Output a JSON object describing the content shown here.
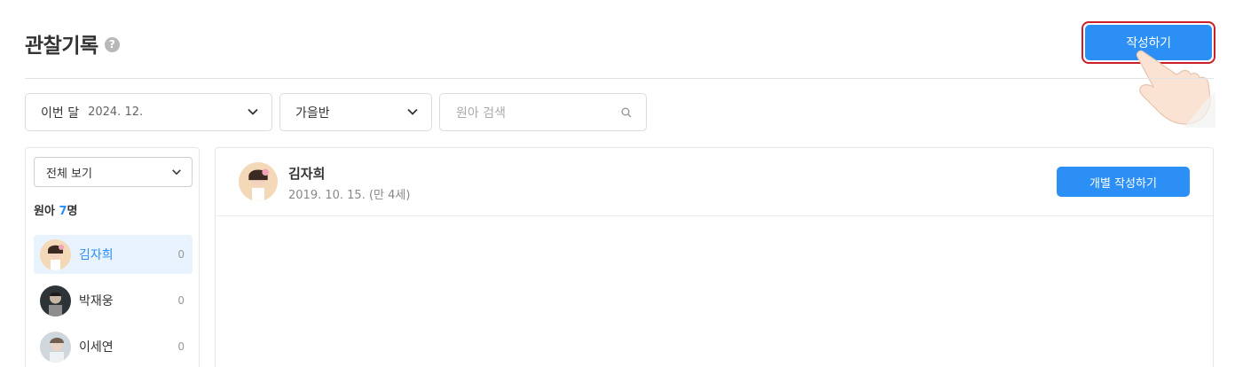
{
  "header": {
    "title": "관찰기록",
    "help_icon": "?",
    "write_button": "작성하기"
  },
  "filters": {
    "month_label": "이번 달",
    "month_value": "2024. 12.",
    "class_value": "가을반",
    "search_placeholder": "원아 검색"
  },
  "sidebar": {
    "view_select": "전체 보기",
    "count_prefix": "원아 ",
    "count_number": "7",
    "count_suffix": "명",
    "children": [
      {
        "name": "김자희",
        "count": "0",
        "active": true,
        "avatar": "avatar-child-pink"
      },
      {
        "name": "박재웅",
        "count": "0",
        "active": false,
        "avatar": "avatar-child-dark"
      },
      {
        "name": "이세연",
        "count": "0",
        "active": false,
        "avatar": "avatar-child-light"
      }
    ]
  },
  "profile": {
    "name": "김자희",
    "birth": "2019. 10. 15. (만 4세)",
    "individual_button": "개별 작성하기"
  },
  "colors": {
    "accent": "#2b8ff5",
    "highlight_border": "#cc1e2b",
    "active_bg": "#e8f3fe"
  }
}
